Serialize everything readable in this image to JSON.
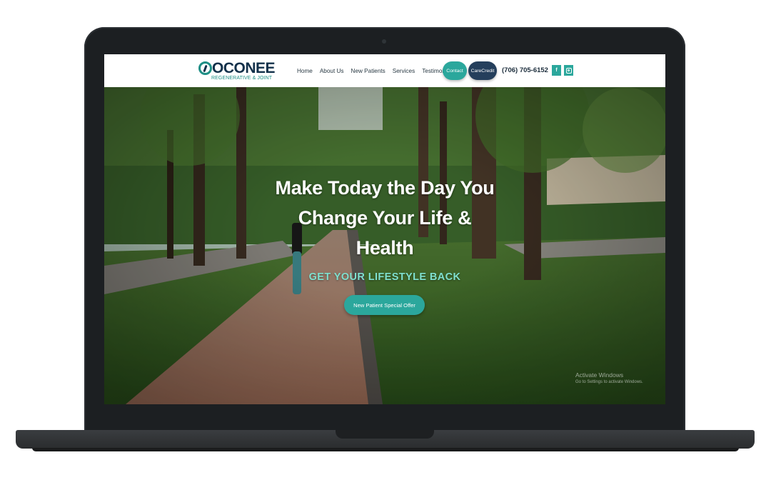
{
  "site": {
    "logo": {
      "name": "OCONEE",
      "tagline": "REGENERATIVE & JOINT"
    },
    "nav": {
      "items": [
        {
          "label": "Home"
        },
        {
          "label": "About Us"
        },
        {
          "label": "New Patients"
        },
        {
          "label": "Services"
        },
        {
          "label": "Testimonials"
        }
      ],
      "contact_label": "Contact",
      "carecredit_label": "CareCredit",
      "phone": "(706) 705-6152",
      "social": {
        "facebook_glyph": "f",
        "facebook_icon": "facebook-icon",
        "instagram_icon": "instagram-icon"
      }
    },
    "hero": {
      "title_lines": [
        "Make Today the Day You",
        "Change Your Life &",
        "Health"
      ],
      "subtitle": "GET YOUR LIFESTYLE BACK",
      "cta_label": "New Patient Special Offer"
    },
    "overlay": {
      "activate_title": "Activate Windows",
      "activate_sub": "Go to Settings to activate Windows."
    }
  },
  "colors": {
    "accent_teal": "#2ba79c",
    "navy": "#253f5c",
    "subtitle_mint": "#7fe0cf",
    "laptop_frame": "#1c1f22"
  }
}
